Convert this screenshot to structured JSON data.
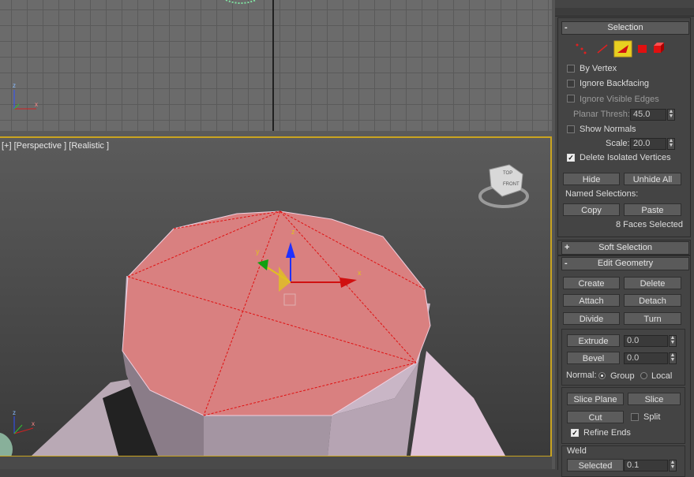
{
  "viewport": {
    "label": "[+] [Perspective ] [Realistic ]",
    "viewcube_top": "TOP",
    "viewcube_front": "FRONT",
    "gizmo_x": "x",
    "gizmo_y": "y",
    "gizmo_z": "z",
    "axis_x": "x",
    "axis_y": "y",
    "axis_z": "z"
  },
  "selection": {
    "title": "Selection",
    "collapse": "-",
    "by_vertex": "By Vertex",
    "ignore_backfacing": "Ignore Backfacing",
    "ignore_visible_edges": "Ignore Visible Edges",
    "planar_thresh_label": "Planar Thresh:",
    "planar_thresh_value": "45.0",
    "show_normals": "Show Normals",
    "scale_label": "Scale:",
    "scale_value": "20.0",
    "delete_isolated": "Delete Isolated Vertices",
    "hide": "Hide",
    "unhide_all": "Unhide All",
    "named_selections": "Named Selections:",
    "copy": "Copy",
    "paste": "Paste",
    "status": "8 Faces Selected"
  },
  "soft_selection": {
    "title": "Soft Selection",
    "expand": "+"
  },
  "edit_geometry": {
    "title": "Edit Geometry",
    "collapse": "-",
    "create": "Create",
    "delete": "Delete",
    "attach": "Attach",
    "detach": "Detach",
    "divide": "Divide",
    "turn": "Turn",
    "extrude": "Extrude",
    "extrude_value": "0.0",
    "bevel": "Bevel",
    "bevel_value": "0.0",
    "normal_label": "Normal:",
    "group": "Group",
    "local": "Local",
    "slice_plane": "Slice Plane",
    "slice": "Slice",
    "cut": "Cut",
    "split": "Split",
    "refine_ends": "Refine Ends",
    "weld": "Weld",
    "selected": "Selected",
    "weld_value": "0.1"
  },
  "colors": {
    "accent": "#c9a420",
    "selection_face": "#d98080",
    "gizmo_x": "#d01010",
    "gizmo_y": "#10a010",
    "gizmo_z": "#2020e0"
  }
}
